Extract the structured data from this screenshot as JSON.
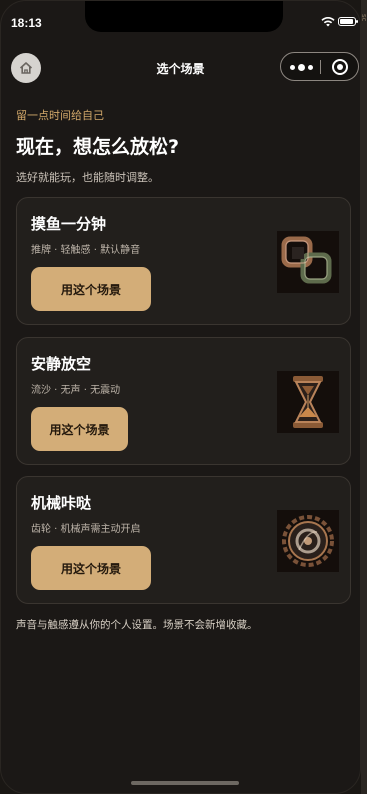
{
  "status_bar": {
    "time": "18:13"
  },
  "nav": {
    "title": "选个场景"
  },
  "header": {
    "eyebrow": "留一点时间给自己",
    "heading": "现在，想怎么放松?",
    "subtitle": "选好就能玩，也能随时调整。"
  },
  "cards": [
    {
      "title": "摸鱼一分钟",
      "tags": "推牌 · 轻触感 · 默认静音",
      "button_label": "用这个场景",
      "image_icon": "sliding-cards-icon"
    },
    {
      "title": "安静放空",
      "tags": "流沙 · 无声 · 无震动",
      "button_label": "用这个场景",
      "image_icon": "hourglass-icon"
    },
    {
      "title": "机械咔哒",
      "tags": "齿轮 · 机械声需主动开启",
      "button_label": "用这个场景",
      "image_icon": "gear-icon"
    }
  ],
  "footnote": "声音与触感遵从你的个人设置。场景不会新增收藏。",
  "colors": {
    "accent": "#d3ad78",
    "eyebrow": "#d2a86a",
    "background": "#1b1816",
    "card": "#221f1c"
  }
}
